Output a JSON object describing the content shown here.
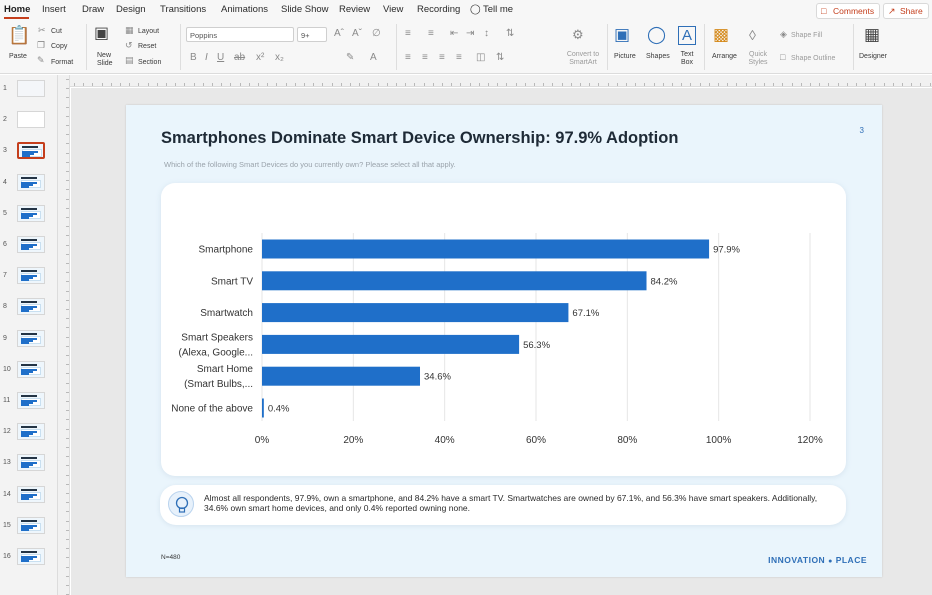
{
  "menu": {
    "tabs": [
      "Home",
      "Insert",
      "Draw",
      "Design",
      "Transitions",
      "Animations",
      "Slide Show",
      "Review",
      "View",
      "Recording"
    ],
    "tell_me": "Tell me",
    "comments_label": "Comments",
    "share_label": "Share"
  },
  "ribbon": {
    "paste": "Paste",
    "cut": "Cut",
    "copy": "Copy",
    "format": "Format",
    "new_slide": "New Slide",
    "layout": "Layout",
    "reset": "Reset",
    "section": "Section",
    "font_name": "Poppins",
    "font_size": "9+",
    "convert_smartart": "Convert to SmartArt",
    "picture": "Picture",
    "shapes": "Shapes",
    "text_box": "Text Box",
    "arrange": "Arrange",
    "quick_styles": "Quick Styles",
    "shape_fill": "Shape Fill",
    "shape_outline": "Shape Outline",
    "designer": "Designer"
  },
  "thumbnails": {
    "numbers": [
      "1",
      "2",
      "3",
      "4",
      "5",
      "6",
      "7",
      "8",
      "9",
      "10",
      "11",
      "12",
      "13",
      "14",
      "15",
      "16"
    ],
    "selected": "3"
  },
  "slide": {
    "title": "Smartphones Dominate Smart Device Ownership: 97.9% Adoption",
    "number": "3",
    "subtitle": "Which of the following Smart Devices do you currently own? Please select all that apply.",
    "note": "Almost all respondents, 97.9%, own a smartphone, and 84.2% have a smart TV. Smartwatches are owned by 67.1%, and 56.3% have smart speakers. Additionally, 34.6% own smart home devices, and only 0.4% reported owning none.",
    "sample_size": "N=480",
    "logo_text": "INNOVATION",
    "logo_text_2": "PLACE"
  },
  "chart_data": {
    "type": "bar",
    "orientation": "horizontal",
    "categories": [
      "Smartphone",
      "Smart TV",
      "Smartwatch",
      "Smart Speakers (Alexa, Google...",
      "Smart Home (Smart Bulbs,...",
      "None of the above"
    ],
    "category_lines": [
      [
        "Smartphone"
      ],
      [
        "Smart TV"
      ],
      [
        "Smartwatch"
      ],
      [
        "Smart Speakers",
        "(Alexa, Google..."
      ],
      [
        "Smart Home",
        "(Smart Bulbs,..."
      ],
      [
        "None of the above"
      ]
    ],
    "values": [
      97.9,
      84.2,
      67.1,
      56.3,
      34.6,
      0.4
    ],
    "value_labels": [
      "97.9%",
      "84.2%",
      "67.1%",
      "56.3%",
      "34.6%",
      "0.4%"
    ],
    "xlim": [
      0,
      120
    ],
    "xticks": [
      0,
      20,
      40,
      60,
      80,
      100,
      120
    ],
    "xtick_labels": [
      "0%",
      "20%",
      "40%",
      "60%",
      "80%",
      "100%",
      "120%"
    ],
    "grid": true,
    "bar_color": "#1f6fc9"
  },
  "colors": {
    "accent": "#c43e1c",
    "bar": "#1f6fc9",
    "slide_bg": "#eaf5fc",
    "title": "#1e2a36"
  }
}
